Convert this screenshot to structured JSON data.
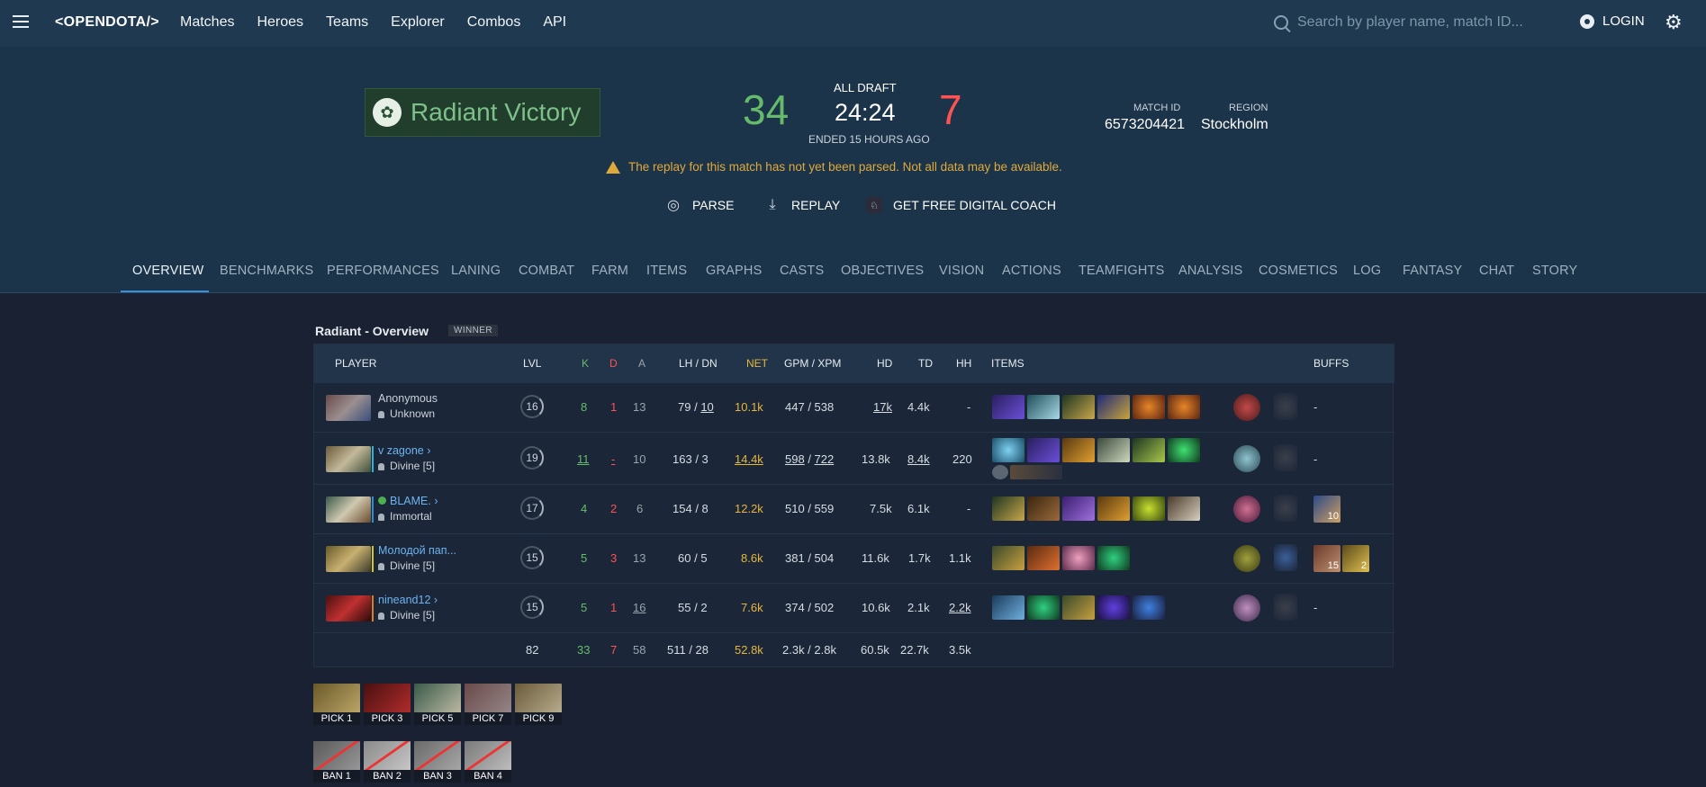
{
  "nav": {
    "logo": "<OPENDOTA/>",
    "links": [
      "Matches",
      "Heroes",
      "Teams",
      "Explorer",
      "Combos",
      "API"
    ],
    "search_placeholder": "Search by player name, match ID...",
    "login": "LOGIN"
  },
  "match": {
    "result": "Radiant Victory",
    "radiant_score": "34",
    "dire_score": "7",
    "mode": "ALL DRAFT",
    "duration": "24:24",
    "ended": "ENDED 15 HOURS AGO",
    "match_id_label": "MATCH ID",
    "match_id": "6573204421",
    "region_label": "REGION",
    "region": "Stockholm",
    "warning": "The replay for this match has not yet been parsed. Not all data may be available.",
    "actions": [
      "PARSE",
      "REPLAY",
      "GET FREE DIGITAL COACH"
    ]
  },
  "tabs": [
    "OVERVIEW",
    "BENCHMARKS",
    "PERFORMANCES",
    "LANING",
    "COMBAT",
    "FARM",
    "ITEMS",
    "GRAPHS",
    "CASTS",
    "OBJECTIVES",
    "VISION",
    "ACTIONS",
    "TEAMFIGHTS",
    "ANALYSIS",
    "COSMETICS",
    "LOG",
    "FANTASY",
    "CHAT",
    "STORY"
  ],
  "overview": {
    "title": "Radiant - Overview",
    "winner_tag": "WINNER",
    "headers": {
      "player": "PLAYER",
      "lvl": "LVL",
      "k": "K",
      "d": "D",
      "a": "A",
      "lhdn": "LH / DN",
      "net": "NET",
      "gpmxpm": "GPM / XPM",
      "hd": "HD",
      "td": "TD",
      "hh": "HH",
      "items": "ITEMS",
      "buffs": "BUFFS"
    },
    "players": [
      {
        "name": "Anonymous",
        "rank": "Unknown",
        "lvl": "16",
        "k": "8",
        "d": "1",
        "a": "13",
        "lh": "79",
        "dn": "10",
        "net": "10.1k",
        "gpm": "447",
        "xpm": "538",
        "hd": "17k",
        "td": "4.4k",
        "hh": "-",
        "buffs": "-"
      },
      {
        "name": "v zagone",
        "rank": "Divine [5]",
        "lvl": "19",
        "k": "11",
        "d": "-",
        "a": "10",
        "lh": "163",
        "dn": "3",
        "net": "14.4k",
        "gpm": "598",
        "xpm": "722",
        "hd": "13.8k",
        "td": "8.4k",
        "hh": "220",
        "buffs": "-"
      },
      {
        "name": "BLAME.",
        "rank": "Immortal",
        "lvl": "17",
        "k": "4",
        "d": "2",
        "a": "6",
        "lh": "154",
        "dn": "8",
        "net": "12.2k",
        "gpm": "510",
        "xpm": "559",
        "hd": "7.5k",
        "td": "6.1k",
        "hh": "-",
        "buff_count": "10"
      },
      {
        "name": "Молодой пап...",
        "rank": "Divine [5]",
        "lvl": "15",
        "k": "5",
        "d": "3",
        "a": "13",
        "lh": "60",
        "dn": "5",
        "net": "8.6k",
        "gpm": "381",
        "xpm": "504",
        "hd": "11.6k",
        "td": "1.7k",
        "hh": "1.1k",
        "buff_count_1": "15",
        "buff_count_2": "2"
      },
      {
        "name": "nineand12",
        "rank": "Divine [5]",
        "lvl": "15",
        "k": "5",
        "d": "1",
        "a": "16",
        "lh": "55",
        "dn": "2",
        "net": "7.6k",
        "gpm": "374",
        "xpm": "502",
        "hd": "10.6k",
        "td": "2.1k",
        "hh": "2.2k",
        "buffs": "-"
      }
    ],
    "totals": {
      "lvl": "82",
      "k": "33",
      "d": "7",
      "a": "58",
      "lhdn": "511 / 28",
      "net": "52.8k",
      "gpmxpm": "2.3k / 2.8k",
      "hd": "60.5k",
      "td": "22.7k",
      "hh": "3.5k"
    }
  },
  "picks": [
    "PICK 1",
    "PICK 3",
    "PICK 5",
    "PICK 7",
    "PICK 9"
  ],
  "bans": [
    "BAN 1",
    "BAN 2",
    "BAN 3",
    "BAN 4"
  ]
}
